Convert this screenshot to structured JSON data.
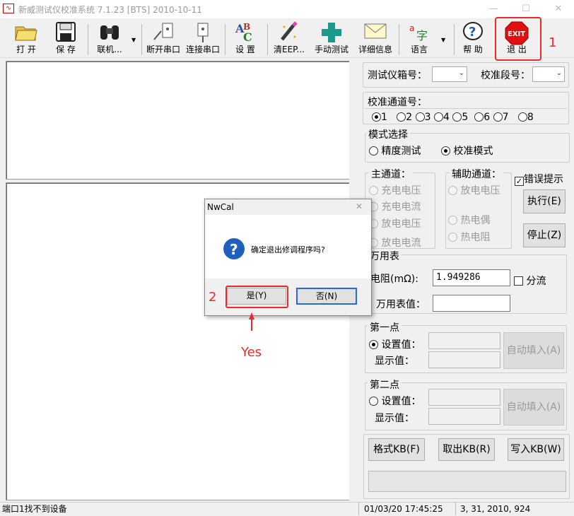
{
  "window": {
    "title": "新威测试仪校准系统 7.1.23    [BTS]  2010-10-11",
    "app_icon": "waveform-icon",
    "minimize": "—",
    "maximize": "☐",
    "close": "✕"
  },
  "toolbar": {
    "open": {
      "label": "打 开",
      "icon": "folder-icon"
    },
    "save": {
      "label": "保 存",
      "icon": "floppy-disk-icon"
    },
    "connect": {
      "label": "联机...",
      "icon": "binoculars-icon"
    },
    "disconnect_port": {
      "label": "断开串口",
      "icon": "unplug-icon"
    },
    "connect_port": {
      "label": "连接串口",
      "icon": "plug-icon"
    },
    "settings": {
      "label": "设 置",
      "icon": "abc-settings-icon"
    },
    "clear_eep": {
      "label": "清EEP...",
      "icon": "eraser-icon"
    },
    "manual_test": {
      "label": "手动测试",
      "icon": "medical-cross-icon"
    },
    "details": {
      "label": "详细信息",
      "icon": "envelope-icon"
    },
    "language": {
      "label": "语言",
      "icon": "language-icon"
    },
    "help": {
      "label": "帮 助",
      "icon": "help-icon"
    },
    "exit": {
      "label": "退 出",
      "icon": "exit-stop-icon",
      "sign": "EXIT"
    }
  },
  "annotations": {
    "step1": "1",
    "step2": "2",
    "yes_note": "Yes",
    "arrow": "▲",
    "color": "#e82a2a"
  },
  "panel": {
    "tester_box_label": "测试仪箱号：",
    "calib_segment_label": "校准段号：",
    "calib_channel_label": "校准通道号：",
    "channels": [
      "1",
      "2",
      "3",
      "4",
      "5",
      "6",
      "7",
      "8"
    ],
    "selected_channel": "1",
    "mode_group": "模式选择",
    "mode_precision": "精度测试",
    "mode_calibration": "校准模式",
    "main_channel": "主通道：",
    "aux_channel": "辅助通道：",
    "error_prompt": "错误提示",
    "main_options": [
      "充电电压",
      "充电电流",
      "放电电压",
      "放电电流"
    ],
    "aux_options": [
      "放电电压",
      "热电偶",
      "热电阻"
    ],
    "execute": "执行(E)",
    "stop": "停止(Z)",
    "multimeter_group": "万用表",
    "resistance_label": "电阻(mΩ):",
    "resistance_value": "1.949286",
    "shunt": "分流",
    "multimeter_value_label": "万用表值：",
    "point1_group": "第一点",
    "point2_group": "第二点",
    "set_value": "设置值：",
    "display_value": "显示值：",
    "auto_fill": "自动填入(A)",
    "format_kb": "格式KB(F)",
    "fetch_kb": "取出KB(R)",
    "write_kb": "写入KB(W)"
  },
  "dialog": {
    "title": "NwCal",
    "close": "✕",
    "message": "确定退出修调程序吗?",
    "yes": "是(Y)",
    "no": "否(N)",
    "icon": "question-icon"
  },
  "status": {
    "port": "端口1找不到设备",
    "datetime": "01/03/20 17:45:25",
    "info": "3, 31, 2010, 924"
  }
}
